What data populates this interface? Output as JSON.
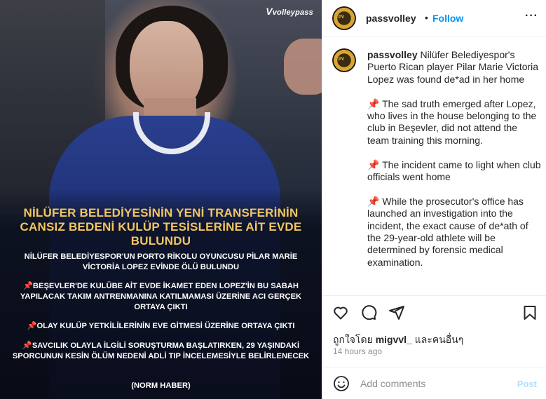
{
  "photo": {
    "logo": "volleypass",
    "headline": "NİLÜFER BELEDİYESİNİN YENİ TRANSFERİNİN CANSIZ BEDENİ KULÜP TESİSLERİNE AİT EVDE BULUNDU",
    "line1": "NİLÜFER BELEDİYESPOR'UN PORTO RİKOLU OYUNCUSU PİLAR MARİE VİCTORİA LOPEZ EVİNDE ÖLÜ BULUNDU",
    "line2": "BEŞEVLER'DE KULÜBE AİT EVDE İKAMET EDEN LOPEZ'İN BU SABAH YAPILACAK TAKIM ANTRENMANINA KATILMAMASI ÜZERİNE ACI GERÇEK ORTAYA ÇIKTI",
    "line3": "OLAY KULÜP YETKİLİLERİNİN EVE GİTMESİ ÜZERİNE ORTAYA ÇIKTI",
    "line4": "SAVCILIK OLAYLA İLGİLİ SORUŞTURMA BAŞLATIRKEN, 29 YAŞINDAKİ SPORCUNUN KESİN ÖLÜM NEDENİ ADLİ TIP İNCELEMESİYLE BELİRLENECEK",
    "source": "(NORM HABER)"
  },
  "header": {
    "username": "passvolley",
    "separator": "•",
    "follow_label": "Follow",
    "more_label": "···"
  },
  "caption": {
    "username": "passvolley",
    "intro": "Nilüfer Belediyespor's Puerto Rican player Pilar Marie Victoria Lopez was found de*ad in her home",
    "para1": "The sad truth emerged after Lopez, who lives in the house belonging to the club in Beşevler, did not attend the team training this morning.",
    "para2": "The incident came to light when club officials went home",
    "para3": "While the prosecutor's office has launched an investigation into the incident, the exact cause of de*ath of the 29-year-old athlete will be determined by forensic medical examination.",
    "pin": "📌"
  },
  "engagement": {
    "liked_prefix": "ถูกใจโดย",
    "liked_user": "migvvl_",
    "liked_suffix": "และคนอื่นๆ",
    "time": "14 hours ago"
  },
  "composer": {
    "placeholder": "Add comments",
    "post_label": "Post"
  },
  "colors": {
    "accent": "#0095f6",
    "headline": "#f2c660",
    "pin": "#e0443a"
  }
}
